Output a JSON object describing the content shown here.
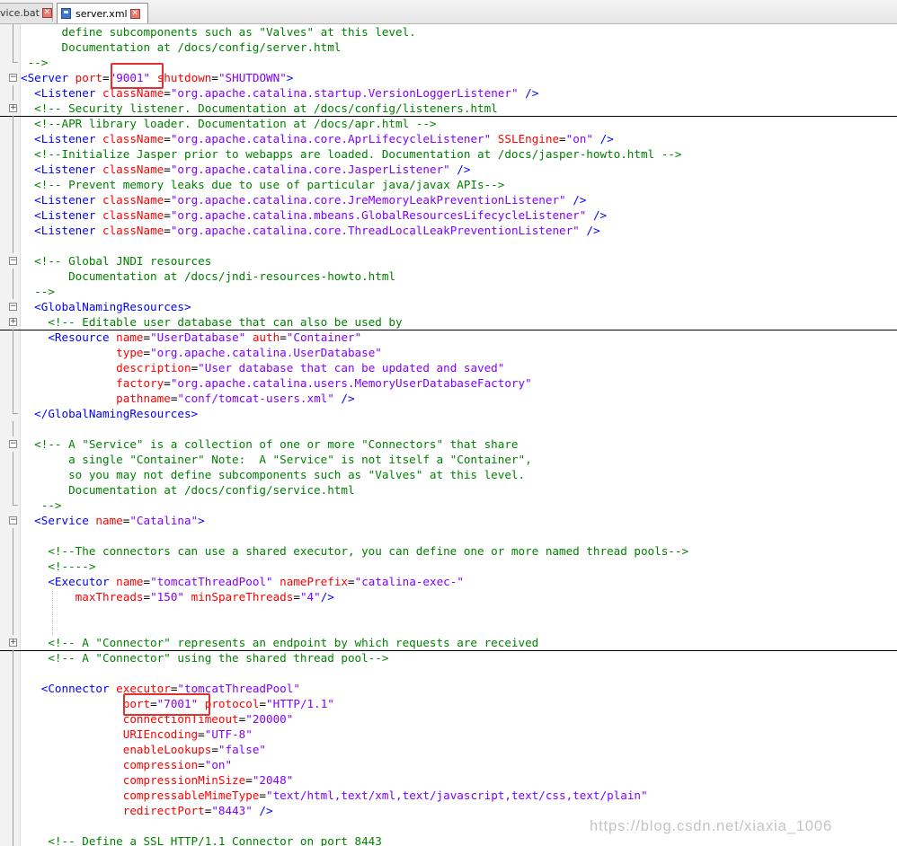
{
  "tabs": [
    {
      "label": "vice.bat",
      "active": false
    },
    {
      "label": "server.xml",
      "active": true
    }
  ],
  "code_lines": [
    {
      "mark": "tree",
      "segments": [
        {
          "c": "c",
          "t": "      define subcomponents such as \"Valves\" at this level."
        }
      ]
    },
    {
      "mark": "tree",
      "segments": [
        {
          "c": "c",
          "t": "      Documentation at /docs/config/server.html"
        }
      ]
    },
    {
      "mark": "end",
      "segments": [
        {
          "c": "c",
          "t": " -->"
        }
      ]
    },
    {
      "mark": "minus",
      "segments": [
        {
          "c": "t",
          "t": "<Server "
        },
        {
          "c": "a",
          "t": "port"
        },
        {
          "c": "p",
          "t": "="
        },
        {
          "c": "v",
          "t": "\"9001\""
        },
        {
          "c": "p",
          "t": " "
        },
        {
          "c": "a",
          "t": "shutdown"
        },
        {
          "c": "p",
          "t": "="
        },
        {
          "c": "v",
          "t": "\"SHUTDOWN\""
        },
        {
          "c": "t",
          "t": ">"
        }
      ]
    },
    {
      "mark": "tree",
      "segments": [
        {
          "c": "t",
          "t": "  <Listener "
        },
        {
          "c": "a",
          "t": "className"
        },
        {
          "c": "p",
          "t": "="
        },
        {
          "c": "v",
          "t": "\"org.apache.catalina.startup.VersionLoggerListener\""
        },
        {
          "c": "t",
          "t": " />"
        }
      ]
    },
    {
      "mark": "plus",
      "collapsed": true,
      "segments": [
        {
          "c": "c",
          "t": "  <!-- Security listener. Documentation at /docs/config/listeners.html"
        }
      ]
    },
    {
      "mark": "tree",
      "segments": [
        {
          "c": "c",
          "t": "  <!--APR library loader. Documentation at /docs/apr.html -->"
        }
      ]
    },
    {
      "mark": "tree",
      "segments": [
        {
          "c": "t",
          "t": "  <Listener "
        },
        {
          "c": "a",
          "t": "className"
        },
        {
          "c": "p",
          "t": "="
        },
        {
          "c": "v",
          "t": "\"org.apache.catalina.core.AprLifecycleListener\""
        },
        {
          "c": "p",
          "t": " "
        },
        {
          "c": "a",
          "t": "SSLEngine"
        },
        {
          "c": "p",
          "t": "="
        },
        {
          "c": "v",
          "t": "\"on\""
        },
        {
          "c": "t",
          "t": " />"
        }
      ]
    },
    {
      "mark": "tree",
      "segments": [
        {
          "c": "c",
          "t": "  <!--Initialize Jasper prior to webapps are loaded. Documentation at /docs/jasper-howto.html -->"
        }
      ]
    },
    {
      "mark": "tree",
      "segments": [
        {
          "c": "t",
          "t": "  <Listener "
        },
        {
          "c": "a",
          "t": "className"
        },
        {
          "c": "p",
          "t": "="
        },
        {
          "c": "v",
          "t": "\"org.apache.catalina.core.JasperListener\""
        },
        {
          "c": "t",
          "t": " />"
        }
      ]
    },
    {
      "mark": "tree",
      "segments": [
        {
          "c": "c",
          "t": "  <!-- Prevent memory leaks due to use of particular java/javax APIs-->"
        }
      ]
    },
    {
      "mark": "tree",
      "segments": [
        {
          "c": "t",
          "t": "  <Listener "
        },
        {
          "c": "a",
          "t": "className"
        },
        {
          "c": "p",
          "t": "="
        },
        {
          "c": "v",
          "t": "\"org.apache.catalina.core.JreMemoryLeakPreventionListener\""
        },
        {
          "c": "t",
          "t": " />"
        }
      ]
    },
    {
      "mark": "tree",
      "segments": [
        {
          "c": "t",
          "t": "  <Listener "
        },
        {
          "c": "a",
          "t": "className"
        },
        {
          "c": "p",
          "t": "="
        },
        {
          "c": "v",
          "t": "\"org.apache.catalina.mbeans.GlobalResourcesLifecycleListener\""
        },
        {
          "c": "t",
          "t": " />"
        }
      ]
    },
    {
      "mark": "tree",
      "segments": [
        {
          "c": "t",
          "t": "  <Listener "
        },
        {
          "c": "a",
          "t": "className"
        },
        {
          "c": "p",
          "t": "="
        },
        {
          "c": "v",
          "t": "\"org.apache.catalina.core.ThreadLocalLeakPreventionListener\""
        },
        {
          "c": "t",
          "t": " />"
        }
      ]
    },
    {
      "mark": "tree",
      "segments": []
    },
    {
      "mark": "minus",
      "segments": [
        {
          "c": "c",
          "t": "  <!-- Global JNDI resources"
        }
      ]
    },
    {
      "mark": "tree",
      "segments": [
        {
          "c": "c",
          "t": "       Documentation at /docs/jndi-resources-howto.html"
        }
      ]
    },
    {
      "mark": "tree",
      "segments": [
        {
          "c": "c",
          "t": "  -->"
        }
      ]
    },
    {
      "mark": "minus",
      "segments": [
        {
          "c": "t",
          "t": "  <GlobalNamingResources>"
        }
      ]
    },
    {
      "mark": "plus",
      "collapsed": true,
      "segments": [
        {
          "c": "c",
          "t": "    <!-- Editable user database that can also be used by"
        }
      ]
    },
    {
      "mark": "tree",
      "segments": [
        {
          "c": "t",
          "t": "    <Resource "
        },
        {
          "c": "a",
          "t": "name"
        },
        {
          "c": "p",
          "t": "="
        },
        {
          "c": "v",
          "t": "\"UserDatabase\""
        },
        {
          "c": "p",
          "t": " "
        },
        {
          "c": "a",
          "t": "auth"
        },
        {
          "c": "p",
          "t": "="
        },
        {
          "c": "v",
          "t": "\"Container\""
        }
      ]
    },
    {
      "mark": "tree",
      "segments": [
        {
          "c": "p",
          "t": "              "
        },
        {
          "c": "a",
          "t": "type"
        },
        {
          "c": "p",
          "t": "="
        },
        {
          "c": "v",
          "t": "\"org.apache.catalina.UserDatabase\""
        }
      ]
    },
    {
      "mark": "tree",
      "segments": [
        {
          "c": "p",
          "t": "              "
        },
        {
          "c": "a",
          "t": "description"
        },
        {
          "c": "p",
          "t": "="
        },
        {
          "c": "v",
          "t": "\"User database that can be updated and saved\""
        }
      ]
    },
    {
      "mark": "tree",
      "segments": [
        {
          "c": "p",
          "t": "              "
        },
        {
          "c": "a",
          "t": "factory"
        },
        {
          "c": "p",
          "t": "="
        },
        {
          "c": "v",
          "t": "\"org.apache.catalina.users.MemoryUserDatabaseFactory\""
        }
      ]
    },
    {
      "mark": "tree",
      "segments": [
        {
          "c": "p",
          "t": "              "
        },
        {
          "c": "a",
          "t": "pathname"
        },
        {
          "c": "p",
          "t": "="
        },
        {
          "c": "v",
          "t": "\"conf/tomcat-users.xml\""
        },
        {
          "c": "t",
          "t": " />"
        }
      ]
    },
    {
      "mark": "end",
      "segments": [
        {
          "c": "t",
          "t": "  </GlobalNamingResources>"
        }
      ]
    },
    {
      "mark": "tree",
      "segments": []
    },
    {
      "mark": "minus",
      "segments": [
        {
          "c": "c",
          "t": "  <!-- A \"Service\" is a collection of one or more \"Connectors\" that share"
        }
      ]
    },
    {
      "mark": "tree",
      "segments": [
        {
          "c": "c",
          "t": "       a single \"Container\" Note:  A \"Service\" is not itself a \"Container\","
        }
      ]
    },
    {
      "mark": "tree",
      "segments": [
        {
          "c": "c",
          "t": "       so you may not define subcomponents such as \"Valves\" at this level."
        }
      ]
    },
    {
      "mark": "tree",
      "segments": [
        {
          "c": "c",
          "t": "       Documentation at /docs/config/service.html"
        }
      ]
    },
    {
      "mark": "end",
      "segments": [
        {
          "c": "c",
          "t": "   -->"
        }
      ]
    },
    {
      "mark": "minus",
      "segments": [
        {
          "c": "t",
          "t": "  <Service "
        },
        {
          "c": "a",
          "t": "name"
        },
        {
          "c": "p",
          "t": "="
        },
        {
          "c": "v",
          "t": "\"Catalina\""
        },
        {
          "c": "t",
          "t": ">"
        }
      ]
    },
    {
      "mark": "tree",
      "segments": []
    },
    {
      "mark": "tree",
      "segments": [
        {
          "c": "c",
          "t": "    <!--The connectors can use a shared executor, you can define one or more named thread pools-->"
        }
      ]
    },
    {
      "mark": "tree",
      "segments": [
        {
          "c": "c",
          "t": "    <!---->"
        }
      ]
    },
    {
      "mark": "tree",
      "segments": [
        {
          "c": "t",
          "t": "    <Executor "
        },
        {
          "c": "a",
          "t": "name"
        },
        {
          "c": "p",
          "t": "="
        },
        {
          "c": "v",
          "t": "\"tomcatThreadPool\""
        },
        {
          "c": "p",
          "t": " "
        },
        {
          "c": "a",
          "t": "namePrefix"
        },
        {
          "c": "p",
          "t": "="
        },
        {
          "c": "v",
          "t": "\"catalina-exec-\""
        }
      ]
    },
    {
      "mark": "tree",
      "segments": [
        {
          "c": "p",
          "t": "        "
        },
        {
          "c": "a",
          "t": "maxThreads"
        },
        {
          "c": "p",
          "t": "="
        },
        {
          "c": "v",
          "t": "\"150\""
        },
        {
          "c": "p",
          "t": " "
        },
        {
          "c": "a",
          "t": "minSpareThreads"
        },
        {
          "c": "p",
          "t": "="
        },
        {
          "c": "v",
          "t": "\"4\""
        },
        {
          "c": "t",
          "t": "/>"
        }
      ]
    },
    {
      "mark": "tree",
      "segments": []
    },
    {
      "mark": "tree",
      "segments": []
    },
    {
      "mark": "plus",
      "collapsed": true,
      "segments": [
        {
          "c": "c",
          "t": "    <!-- A \"Connector\" represents an endpoint by which requests are received"
        }
      ]
    },
    {
      "mark": "tree",
      "segments": [
        {
          "c": "c",
          "t": "    <!-- A \"Connector\" using the shared thread pool-->"
        }
      ]
    },
    {
      "mark": "tree",
      "segments": []
    },
    {
      "mark": "tree",
      "segments": [
        {
          "c": "t",
          "t": "   <Connector "
        },
        {
          "c": "a",
          "t": "executor"
        },
        {
          "c": "p",
          "t": "="
        },
        {
          "c": "v",
          "t": "\"tomcatThreadPool\""
        }
      ]
    },
    {
      "mark": "tree",
      "segments": [
        {
          "c": "p",
          "t": "               "
        },
        {
          "c": "a",
          "t": "port"
        },
        {
          "c": "p",
          "t": "="
        },
        {
          "c": "v",
          "t": "\"7001\""
        },
        {
          "c": "p",
          "t": " "
        },
        {
          "c": "a",
          "t": "protocol"
        },
        {
          "c": "p",
          "t": "="
        },
        {
          "c": "v",
          "t": "\"HTTP/1.1\""
        }
      ]
    },
    {
      "mark": "tree",
      "segments": [
        {
          "c": "p",
          "t": "               "
        },
        {
          "c": "a",
          "t": "connectionTimeout"
        },
        {
          "c": "p",
          "t": "="
        },
        {
          "c": "v",
          "t": "\"20000\""
        }
      ]
    },
    {
      "mark": "tree",
      "segments": [
        {
          "c": "p",
          "t": "               "
        },
        {
          "c": "a",
          "t": "URIEncoding"
        },
        {
          "c": "p",
          "t": "="
        },
        {
          "c": "v",
          "t": "\"UTF-8\""
        }
      ]
    },
    {
      "mark": "tree",
      "segments": [
        {
          "c": "p",
          "t": "               "
        },
        {
          "c": "a",
          "t": "enableLookups"
        },
        {
          "c": "p",
          "t": "="
        },
        {
          "c": "v",
          "t": "\"false\""
        }
      ]
    },
    {
      "mark": "tree",
      "segments": [
        {
          "c": "p",
          "t": "               "
        },
        {
          "c": "a",
          "t": "compression"
        },
        {
          "c": "p",
          "t": "="
        },
        {
          "c": "v",
          "t": "\"on\""
        }
      ]
    },
    {
      "mark": "tree",
      "segments": [
        {
          "c": "p",
          "t": "               "
        },
        {
          "c": "a",
          "t": "compressionMinSize"
        },
        {
          "c": "p",
          "t": "="
        },
        {
          "c": "v",
          "t": "\"2048\""
        }
      ]
    },
    {
      "mark": "tree",
      "segments": [
        {
          "c": "p",
          "t": "               "
        },
        {
          "c": "a",
          "t": "compressableMimeType"
        },
        {
          "c": "p",
          "t": "="
        },
        {
          "c": "v",
          "t": "\"text/html,text/xml,text/javascript,text/css,text/plain\""
        }
      ]
    },
    {
      "mark": "tree",
      "segments": [
        {
          "c": "p",
          "t": "               "
        },
        {
          "c": "a",
          "t": "redirectPort"
        },
        {
          "c": "p",
          "t": "="
        },
        {
          "c": "v",
          "t": "\"8443\""
        },
        {
          "c": "t",
          "t": " />"
        }
      ]
    },
    {
      "mark": "tree",
      "segments": []
    },
    {
      "mark": "tree",
      "segments": [
        {
          "c": "c",
          "t": "    <!-- Define a SSL HTTP/1.1 Connector on port 8443"
        }
      ]
    }
  ],
  "highlights": [
    {
      "label": "server-port-value-highlight"
    },
    {
      "label": "connector-port-attribute-highlight"
    }
  ],
  "watermark": "https://blog.csdn.net/xiaxia_1006",
  "colors": {
    "comment": "#008000",
    "tag": "#0000ff",
    "attribute": "#ff0000",
    "value": "#8000ff",
    "highlight": "#e03030"
  }
}
